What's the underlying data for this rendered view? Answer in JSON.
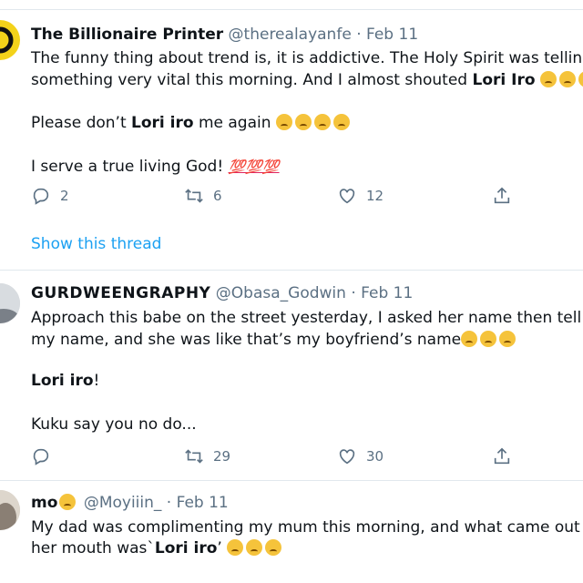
{
  "tweets": [
    {
      "name": "The Billionaire Printer",
      "handle": "@therealayanfe",
      "sep": "·",
      "date": "Feb 11",
      "line1": "The funny thing about trend is, it is addictive. The Holy Spirit was telling m",
      "line2_pre": "something very vital this morning. And I almost shouted ",
      "line2_bold": "Lori Iro",
      "line3_pre": "Please don’t ",
      "line3_bold": "Lori iro",
      "line3_post": " me again",
      "line4": "I serve a true living God!",
      "hundreds": "💯💯💯",
      "replies": "2",
      "retweets": "6",
      "likes": "12",
      "show_thread": "Show this thread"
    },
    {
      "name": "GURDWEENGRAPHY",
      "handle": "@Obasa_Godwin",
      "sep": "·",
      "date": "Feb 11",
      "line1": "Approach this babe on the street yesterday, I asked her name then tell her",
      "line2": "my name, and she was like that’s my boyfriend’s name",
      "line3_bold": "Lori iro",
      "line3_post": "!",
      "line4": "Kuku say you no do...",
      "replies": "",
      "retweets": "29",
      "likes": "30"
    },
    {
      "name": "mo",
      "handle": "@Moyiiin_",
      "sep": "·",
      "date": "Feb 11",
      "line1": "My dad was complimenting my mum this morning, and what came out of",
      "line2_pre": "her mouth was`",
      "line2_bold": "Lori iro",
      "line2_post": "’"
    }
  ],
  "colors": {
    "link": "#1da1f2",
    "meta": "#5b7083",
    "divider": "#e1e8ed"
  }
}
